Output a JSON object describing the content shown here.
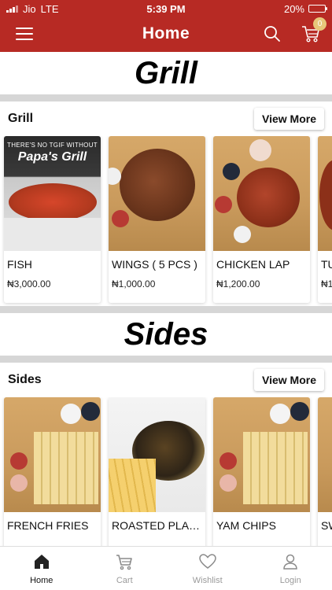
{
  "status_bar": {
    "carrier": "Jio",
    "network": "LTE",
    "time": "5:39 PM",
    "battery": "20%",
    "battery_level": 0.2
  },
  "header": {
    "title": "Home",
    "cart_count": "0",
    "icons": [
      "menu-icon",
      "search-icon",
      "cart-icon"
    ]
  },
  "sections": [
    {
      "banner": "Grill",
      "title": "Grill",
      "view_more": "View More",
      "items": [
        {
          "name": "FISH",
          "price": "₦3,000.00",
          "image_text_1": "THERE'S NO TGIF WITHOUT",
          "image_text_2": "Papa's Grill"
        },
        {
          "name": "WINGS ( 5 PCS )",
          "price": "₦1,000.00"
        },
        {
          "name": "CHICKEN LAP",
          "price": "₦1,200.00"
        },
        {
          "name": "TU",
          "price": "₦1"
        }
      ]
    },
    {
      "banner": "Sides",
      "title": "Sides",
      "view_more": "View More",
      "items": [
        {
          "name": "FRENCH FRIES",
          "price": ""
        },
        {
          "name": "ROASTED PLAN...",
          "price": ""
        },
        {
          "name": "YAM CHIPS",
          "price": ""
        },
        {
          "name": "SW",
          "price": ""
        }
      ]
    }
  ],
  "tabs": [
    {
      "label": "Home",
      "icon": "home-icon",
      "active": true
    },
    {
      "label": "Cart",
      "icon": "cart-icon",
      "active": false
    },
    {
      "label": "Wishlist",
      "icon": "heart-icon",
      "active": false
    },
    {
      "label": "Login",
      "icon": "user-icon",
      "active": false
    }
  ],
  "colors": {
    "brand": "#b72a24",
    "badge": "#e7c77a",
    "separator": "#d6d6d6"
  }
}
